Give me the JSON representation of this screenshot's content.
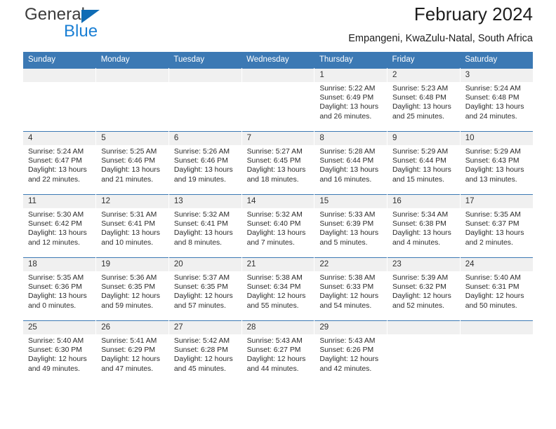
{
  "brand": {
    "line1": "General",
    "line2": "Blue",
    "triangle_color": "#0f6cb5"
  },
  "header": {
    "title": "February 2024",
    "subtitle": "Empangeni, KwaZulu-Natal, South Africa"
  },
  "theme": {
    "header_blue": "#3c79b4",
    "daynum_bg": "#f0f0f0",
    "brand_blue": "#1a7fd4"
  },
  "weekdays": [
    "Sunday",
    "Monday",
    "Tuesday",
    "Wednesday",
    "Thursday",
    "Friday",
    "Saturday"
  ],
  "labels": {
    "sunrise_prefix": "Sunrise: ",
    "sunset_prefix": "Sunset: ",
    "daylight_prefix": "Daylight: "
  },
  "weeks": [
    [
      {
        "day": "",
        "empty": true
      },
      {
        "day": "",
        "empty": true
      },
      {
        "day": "",
        "empty": true
      },
      {
        "day": "",
        "empty": true
      },
      {
        "day": "1",
        "sunrise": "Sunrise: 5:22 AM",
        "sunset": "Sunset: 6:49 PM",
        "daylight": "Daylight: 13 hours and 26 minutes."
      },
      {
        "day": "2",
        "sunrise": "Sunrise: 5:23 AM",
        "sunset": "Sunset: 6:48 PM",
        "daylight": "Daylight: 13 hours and 25 minutes."
      },
      {
        "day": "3",
        "sunrise": "Sunrise: 5:24 AM",
        "sunset": "Sunset: 6:48 PM",
        "daylight": "Daylight: 13 hours and 24 minutes."
      }
    ],
    [
      {
        "day": "4",
        "sunrise": "Sunrise: 5:24 AM",
        "sunset": "Sunset: 6:47 PM",
        "daylight": "Daylight: 13 hours and 22 minutes."
      },
      {
        "day": "5",
        "sunrise": "Sunrise: 5:25 AM",
        "sunset": "Sunset: 6:46 PM",
        "daylight": "Daylight: 13 hours and 21 minutes."
      },
      {
        "day": "6",
        "sunrise": "Sunrise: 5:26 AM",
        "sunset": "Sunset: 6:46 PM",
        "daylight": "Daylight: 13 hours and 19 minutes."
      },
      {
        "day": "7",
        "sunrise": "Sunrise: 5:27 AM",
        "sunset": "Sunset: 6:45 PM",
        "daylight": "Daylight: 13 hours and 18 minutes."
      },
      {
        "day": "8",
        "sunrise": "Sunrise: 5:28 AM",
        "sunset": "Sunset: 6:44 PM",
        "daylight": "Daylight: 13 hours and 16 minutes."
      },
      {
        "day": "9",
        "sunrise": "Sunrise: 5:29 AM",
        "sunset": "Sunset: 6:44 PM",
        "daylight": "Daylight: 13 hours and 15 minutes."
      },
      {
        "day": "10",
        "sunrise": "Sunrise: 5:29 AM",
        "sunset": "Sunset: 6:43 PM",
        "daylight": "Daylight: 13 hours and 13 minutes."
      }
    ],
    [
      {
        "day": "11",
        "sunrise": "Sunrise: 5:30 AM",
        "sunset": "Sunset: 6:42 PM",
        "daylight": "Daylight: 13 hours and 12 minutes."
      },
      {
        "day": "12",
        "sunrise": "Sunrise: 5:31 AM",
        "sunset": "Sunset: 6:41 PM",
        "daylight": "Daylight: 13 hours and 10 minutes."
      },
      {
        "day": "13",
        "sunrise": "Sunrise: 5:32 AM",
        "sunset": "Sunset: 6:41 PM",
        "daylight": "Daylight: 13 hours and 8 minutes."
      },
      {
        "day": "14",
        "sunrise": "Sunrise: 5:32 AM",
        "sunset": "Sunset: 6:40 PM",
        "daylight": "Daylight: 13 hours and 7 minutes."
      },
      {
        "day": "15",
        "sunrise": "Sunrise: 5:33 AM",
        "sunset": "Sunset: 6:39 PM",
        "daylight": "Daylight: 13 hours and 5 minutes."
      },
      {
        "day": "16",
        "sunrise": "Sunrise: 5:34 AM",
        "sunset": "Sunset: 6:38 PM",
        "daylight": "Daylight: 13 hours and 4 minutes."
      },
      {
        "day": "17",
        "sunrise": "Sunrise: 5:35 AM",
        "sunset": "Sunset: 6:37 PM",
        "daylight": "Daylight: 13 hours and 2 minutes."
      }
    ],
    [
      {
        "day": "18",
        "sunrise": "Sunrise: 5:35 AM",
        "sunset": "Sunset: 6:36 PM",
        "daylight": "Daylight: 13 hours and 0 minutes."
      },
      {
        "day": "19",
        "sunrise": "Sunrise: 5:36 AM",
        "sunset": "Sunset: 6:35 PM",
        "daylight": "Daylight: 12 hours and 59 minutes."
      },
      {
        "day": "20",
        "sunrise": "Sunrise: 5:37 AM",
        "sunset": "Sunset: 6:35 PM",
        "daylight": "Daylight: 12 hours and 57 minutes."
      },
      {
        "day": "21",
        "sunrise": "Sunrise: 5:38 AM",
        "sunset": "Sunset: 6:34 PM",
        "daylight": "Daylight: 12 hours and 55 minutes."
      },
      {
        "day": "22",
        "sunrise": "Sunrise: 5:38 AM",
        "sunset": "Sunset: 6:33 PM",
        "daylight": "Daylight: 12 hours and 54 minutes."
      },
      {
        "day": "23",
        "sunrise": "Sunrise: 5:39 AM",
        "sunset": "Sunset: 6:32 PM",
        "daylight": "Daylight: 12 hours and 52 minutes."
      },
      {
        "day": "24",
        "sunrise": "Sunrise: 5:40 AM",
        "sunset": "Sunset: 6:31 PM",
        "daylight": "Daylight: 12 hours and 50 minutes."
      }
    ],
    [
      {
        "day": "25",
        "sunrise": "Sunrise: 5:40 AM",
        "sunset": "Sunset: 6:30 PM",
        "daylight": "Daylight: 12 hours and 49 minutes."
      },
      {
        "day": "26",
        "sunrise": "Sunrise: 5:41 AM",
        "sunset": "Sunset: 6:29 PM",
        "daylight": "Daylight: 12 hours and 47 minutes."
      },
      {
        "day": "27",
        "sunrise": "Sunrise: 5:42 AM",
        "sunset": "Sunset: 6:28 PM",
        "daylight": "Daylight: 12 hours and 45 minutes."
      },
      {
        "day": "28",
        "sunrise": "Sunrise: 5:43 AM",
        "sunset": "Sunset: 6:27 PM",
        "daylight": "Daylight: 12 hours and 44 minutes."
      },
      {
        "day": "29",
        "sunrise": "Sunrise: 5:43 AM",
        "sunset": "Sunset: 6:26 PM",
        "daylight": "Daylight: 12 hours and 42 minutes."
      },
      {
        "day": "",
        "empty": true
      },
      {
        "day": "",
        "empty": true
      }
    ]
  ]
}
